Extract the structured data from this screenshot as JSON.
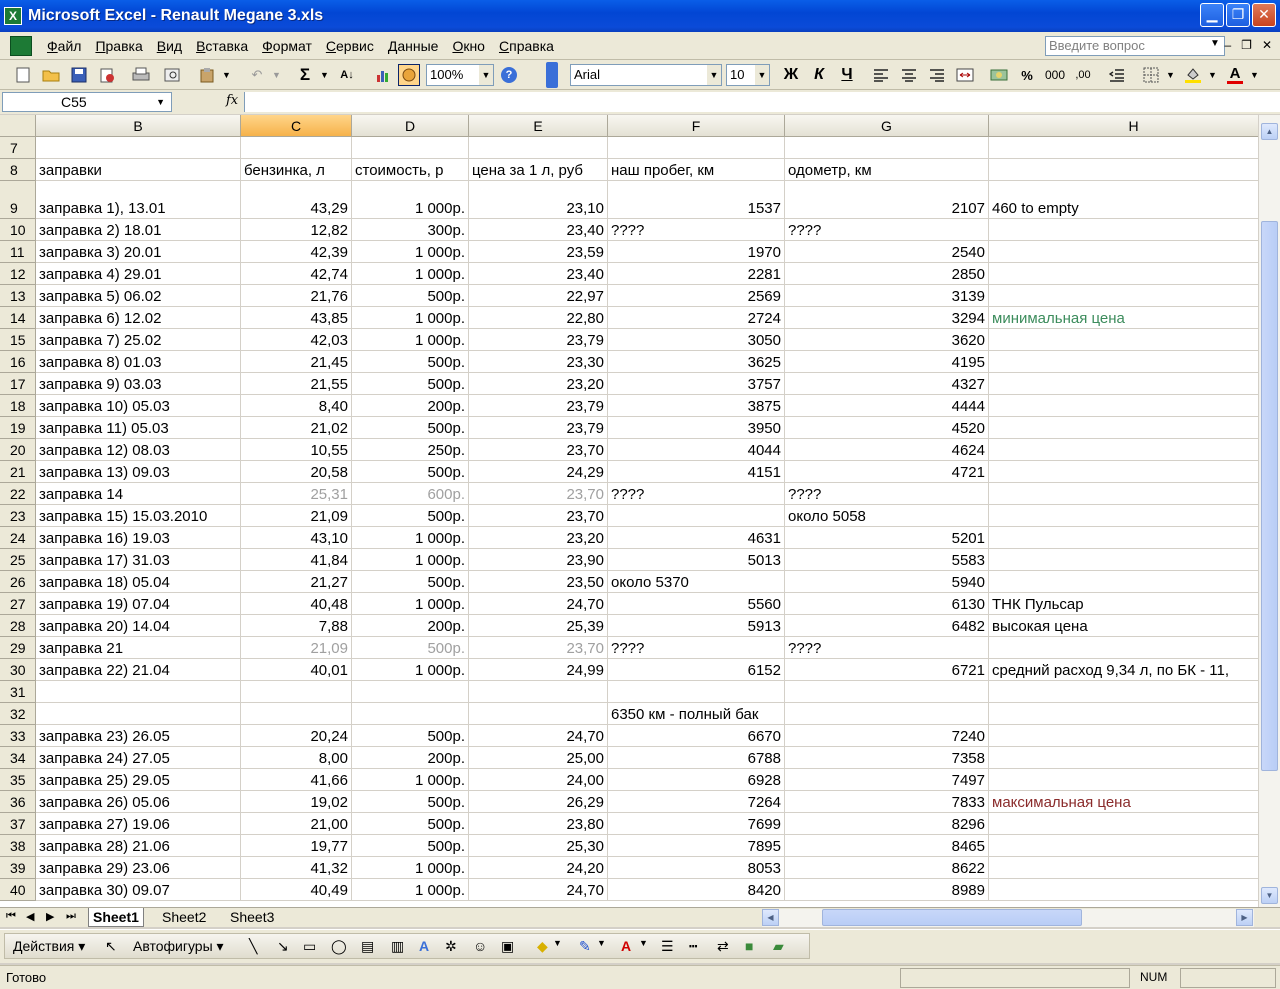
{
  "window": {
    "title": "Microsoft Excel - Renault Megane 3.xls",
    "app_icon": "X",
    "minimize": "▁",
    "restore": "❐",
    "close": "✕"
  },
  "menu": {
    "items": [
      "Файл",
      "Правка",
      "Вид",
      "Вставка",
      "Формат",
      "Сервис",
      "Данные",
      "Окно",
      "Справка"
    ],
    "ask_placeholder": "Введите вопрос",
    "mdi_min": "‒",
    "mdi_restore": "❐",
    "mdi_close": "✕"
  },
  "toolbar": {
    "zoom": "100%",
    "font": "Arial",
    "font_size": "10",
    "bold": "Ж",
    "italic": "К",
    "underline": "Ч",
    "sum": "Σ",
    "percent": "%",
    "thousands": "000",
    "sort": "А↓",
    "help": "?",
    "decimals": ",00",
    "font_color_glyph": "A"
  },
  "formula_bar": {
    "name_box": "C55",
    "fx": "fx",
    "formula": ""
  },
  "grid": {
    "columns": [
      {
        "label": "",
        "key": "corner"
      },
      {
        "label": "B"
      },
      {
        "label": "C",
        "active": true
      },
      {
        "label": "D"
      },
      {
        "label": "E"
      },
      {
        "label": "F"
      },
      {
        "label": "G"
      },
      {
        "label": "H"
      }
    ],
    "rows": [
      {
        "n": "7",
        "cells": [
          "",
          "",
          "",
          "",
          "",
          "",
          ""
        ]
      },
      {
        "n": "8",
        "cells": [
          "заправки",
          "бензинка, л",
          "стоимость, р",
          "цена за 1 л, руб",
          "наш пробег, км",
          "одометр, км",
          ""
        ]
      },
      {
        "n": "9",
        "cells": [
          "заправка 1), 13.01",
          "43,29",
          "1 000р.",
          "23,10",
          "1537",
          "2107",
          "460 to empty"
        ]
      },
      {
        "n": "10",
        "cells": [
          "заправка 2) 18.01",
          "12,82",
          "300р.",
          "23,40",
          "????",
          "????",
          ""
        ]
      },
      {
        "n": "11",
        "cells": [
          "заправка 3) 20.01",
          "42,39",
          "1 000р.",
          "23,59",
          "1970",
          "2540",
          ""
        ]
      },
      {
        "n": "12",
        "cells": [
          "заправка 4) 29.01",
          "42,74",
          "1 000р.",
          "23,40",
          "2281",
          "2850",
          ""
        ]
      },
      {
        "n": "13",
        "cells": [
          "заправка 5) 06.02",
          "21,76",
          "500р.",
          "22,97",
          "2569",
          "3139",
          ""
        ]
      },
      {
        "n": "14",
        "cells": [
          "заправка 6) 12.02",
          "43,85",
          "1 000р.",
          "22,80",
          "2724",
          "3294",
          "минимальная цена"
        ],
        "h_style": "green"
      },
      {
        "n": "15",
        "cells": [
          "заправка 7) 25.02",
          "42,03",
          "1 000р.",
          "23,79",
          "3050",
          "3620",
          ""
        ]
      },
      {
        "n": "16",
        "cells": [
          "заправка 8) 01.03",
          "21,45",
          "500р.",
          "23,30",
          "3625",
          "4195",
          ""
        ]
      },
      {
        "n": "17",
        "cells": [
          "заправка 9) 03.03",
          "21,55",
          "500р.",
          "23,20",
          "3757",
          "4327",
          ""
        ]
      },
      {
        "n": "18",
        "cells": [
          "заправка 10) 05.03",
          "8,40",
          "200р.",
          "23,79",
          "3875",
          "4444",
          ""
        ]
      },
      {
        "n": "19",
        "cells": [
          "заправка 11) 05.03",
          "21,02",
          "500р.",
          "23,79",
          "3950",
          "4520",
          ""
        ]
      },
      {
        "n": "20",
        "cells": [
          "заправка 12) 08.03",
          "10,55",
          "250р.",
          "23,70",
          "4044",
          "4624",
          ""
        ]
      },
      {
        "n": "21",
        "cells": [
          "заправка 13) 09.03",
          "20,58",
          "500р.",
          "24,29",
          "4151",
          "4721",
          ""
        ]
      },
      {
        "n": "22",
        "cells": [
          "заправка 14",
          "25,31",
          "600р.",
          "23,70",
          "????",
          "????",
          ""
        ],
        "gray": true
      },
      {
        "n": "23",
        "cells": [
          "заправка 15) 15.03.2010",
          "21,09",
          "500р.",
          "23,70",
          "",
          "около 5058",
          ""
        ]
      },
      {
        "n": "24",
        "cells": [
          "заправка 16) 19.03",
          "43,10",
          "1 000р.",
          "23,20",
          "4631",
          "5201",
          ""
        ]
      },
      {
        "n": "25",
        "cells": [
          "заправка 17) 31.03",
          "41,84",
          "1 000р.",
          "23,90",
          "5013",
          "5583",
          ""
        ]
      },
      {
        "n": "26",
        "cells": [
          "заправка 18) 05.04",
          "21,27",
          "500р.",
          "23,50",
          "около 5370",
          "5940",
          ""
        ]
      },
      {
        "n": "27",
        "cells": [
          "заправка 19) 07.04",
          "40,48",
          "1 000р.",
          "24,70",
          "5560",
          "6130",
          "ТНК Пульсар"
        ]
      },
      {
        "n": "28",
        "cells": [
          "заправка 20) 14.04",
          "7,88",
          "200р.",
          "25,39",
          "5913",
          "6482",
          "высокая цена"
        ]
      },
      {
        "n": "29",
        "cells": [
          "заправка 21",
          "21,09",
          "500р.",
          "23,70",
          "????",
          "????",
          ""
        ],
        "gray": true
      },
      {
        "n": "30",
        "cells": [
          "заправка 22) 21.04",
          "40,01",
          "1 000р.",
          "24,99",
          "6152",
          "6721",
          "средний расход 9,34 л, по БК - 11,"
        ]
      },
      {
        "n": "31",
        "cells": [
          "",
          "",
          "",
          "",
          "",
          "",
          ""
        ]
      },
      {
        "n": "32",
        "cells": [
          "",
          "",
          "",
          "",
          "6350 км - полный бак",
          "",
          ""
        ]
      },
      {
        "n": "33",
        "cells": [
          "заправка 23) 26.05",
          "20,24",
          "500р.",
          "24,70",
          "6670",
          "7240",
          ""
        ]
      },
      {
        "n": "34",
        "cells": [
          "заправка 24) 27.05",
          "8,00",
          "200р.",
          "25,00",
          "6788",
          "7358",
          ""
        ]
      },
      {
        "n": "35",
        "cells": [
          "заправка 25) 29.05",
          "41,66",
          "1 000р.",
          "24,00",
          "6928",
          "7497",
          ""
        ]
      },
      {
        "n": "36",
        "cells": [
          "заправка 26) 05.06",
          "19,02",
          "500р.",
          "26,29",
          "7264",
          "7833",
          "максимальная цена"
        ],
        "h_style": "red"
      },
      {
        "n": "37",
        "cells": [
          "заправка 27) 19.06",
          "21,00",
          "500р.",
          "23,80",
          "7699",
          "8296",
          ""
        ]
      },
      {
        "n": "38",
        "cells": [
          "заправка 28) 21.06",
          "19,77",
          "500р.",
          "25,30",
          "7895",
          "8465",
          ""
        ]
      },
      {
        "n": "39",
        "cells": [
          "заправка 29) 23.06",
          "41,32",
          "1 000р.",
          "24,20",
          "8053",
          "8622",
          ""
        ]
      },
      {
        "n": "40",
        "cells": [
          "заправка 30) 09.07",
          "40,49",
          "1 000р.",
          "24,70",
          "8420",
          "8989",
          ""
        ]
      }
    ]
  },
  "sheets": {
    "tabs": [
      "Sheet1",
      "Sheet2",
      "Sheet3"
    ],
    "active": "Sheet1",
    "nav": [
      "⏮",
      "◀",
      "▶",
      "⏭"
    ]
  },
  "drawing": {
    "actions": "Действия",
    "autoshapes": "Автофигуры"
  },
  "status": {
    "ready": "Готово",
    "num": "NUM"
  }
}
